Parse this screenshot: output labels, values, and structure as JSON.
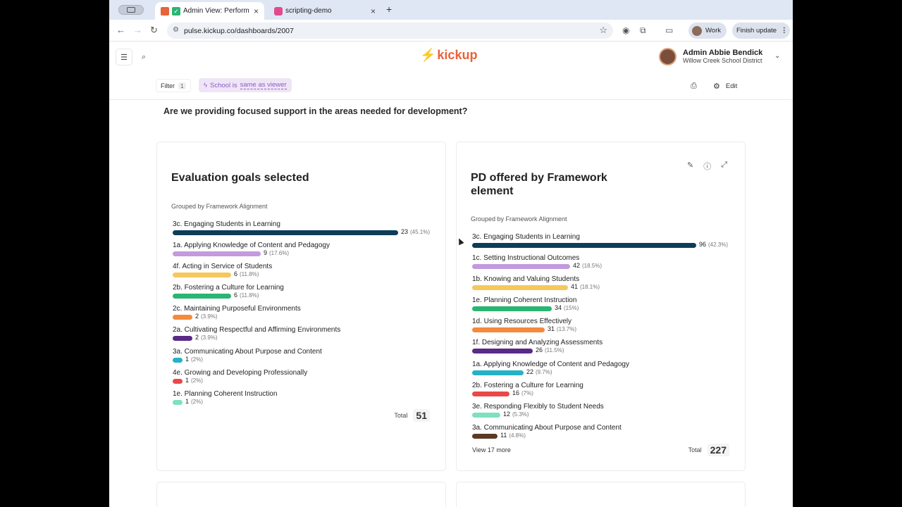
{
  "browser": {
    "tabs": [
      {
        "title": "Admin View: Performance",
        "active": true
      },
      {
        "title": "scripting-demo",
        "active": false
      }
    ],
    "new_tab": "+",
    "close_glyph": "×",
    "url": "pulse.kickup.co/dashboards/2007",
    "profile_label": "Work",
    "finish_update_label": "Finish update"
  },
  "app": {
    "logo_text": "kickup",
    "user_name": "Admin Abbie Bendick",
    "user_org": "Willow Creek School District"
  },
  "filters": {
    "filter_label": "Filter",
    "filter_count": "1",
    "chip_field": "School is",
    "chip_value": "same as viewer",
    "edit_label": "Edit"
  },
  "section": {
    "question": "Are we providing focused support in the areas needed for development?"
  },
  "colors": {
    "brand": "#e8623a",
    "chip_text": "#8c5dc4"
  },
  "cards": [
    {
      "title": "Evaluation goals selected",
      "subtitle": "Grouped by Framework Alignment",
      "total_label": "Total",
      "total_value": "51",
      "max": 23,
      "rows": [
        {
          "label": "3c. Engaging Students in Learning",
          "value": 23,
          "value_text": "23",
          "pct": "(45.1%)",
          "color": "#0d3d57"
        },
        {
          "label": "1a. Applying Knowledge of Content and Pedagogy",
          "value": 9,
          "value_text": "9",
          "pct": "(17.6%)",
          "color": "#c39ade"
        },
        {
          "label": "4f. Acting in Service of Students",
          "value": 6,
          "value_text": "6",
          "pct": "(11.8%)",
          "color": "#f6c75d"
        },
        {
          "label": "2b. Fostering a Culture for Learning",
          "value": 6,
          "value_text": "6",
          "pct": "(11.8%)",
          "color": "#2bb573"
        },
        {
          "label": "2c. Maintaining Purposeful Environments",
          "value": 2,
          "value_text": "2",
          "pct": "(3.9%)",
          "color": "#f58a3c"
        },
        {
          "label": "2a. Cultivating Respectful and Affirming Environments",
          "value": 2,
          "value_text": "2",
          "pct": "(3.9%)",
          "color": "#5a2a86"
        },
        {
          "label": "3a. Communicating About Purpose and Content",
          "value": 1,
          "value_text": "1",
          "pct": "(2%)",
          "color": "#25b1c6"
        },
        {
          "label": "4e. Growing and Developing Professionally",
          "value": 1,
          "value_text": "1",
          "pct": "(2%)",
          "color": "#ea4848"
        },
        {
          "label": "1e. Planning Coherent Instruction",
          "value": 1,
          "value_text": "1",
          "pct": "(2%)",
          "color": "#7ee0bf"
        }
      ]
    },
    {
      "title": "PD offered by Framework element",
      "subtitle": "Grouped by Framework Alignment",
      "total_label": "Total",
      "total_value": "227",
      "view_more": "View 17 more",
      "max": 96,
      "rows": [
        {
          "label": "3c. Engaging Students in Learning",
          "value": 96,
          "value_text": "96",
          "pct": "(42.3%)",
          "color": "#0d3d57"
        },
        {
          "label": "1c. Setting Instructional Outcomes",
          "value": 42,
          "value_text": "42",
          "pct": "(18.5%)",
          "color": "#c39ade"
        },
        {
          "label": "1b. Knowing and Valuing Students",
          "value": 41,
          "value_text": "41",
          "pct": "(18.1%)",
          "color": "#f6c75d"
        },
        {
          "label": "1e. Planning Coherent Instruction",
          "value": 34,
          "value_text": "34",
          "pct": "(15%)",
          "color": "#2bb573"
        },
        {
          "label": "1d. Using Resources Effectively",
          "value": 31,
          "value_text": "31",
          "pct": "(13.7%)",
          "color": "#f58a3c"
        },
        {
          "label": "1f. Designing and Analyzing Assessments",
          "value": 26,
          "value_text": "26",
          "pct": "(11.5%)",
          "color": "#5a2a86"
        },
        {
          "label": "1a. Applying Knowledge of Content and Pedagogy",
          "value": 22,
          "value_text": "22",
          "pct": "(9.7%)",
          "color": "#25b1c6"
        },
        {
          "label": "2b. Fostering a Culture for Learning",
          "value": 16,
          "value_text": "16",
          "pct": "(7%)",
          "color": "#ea4848"
        },
        {
          "label": "3e. Responding Flexibly to Student Needs",
          "value": 12,
          "value_text": "12",
          "pct": "(5.3%)",
          "color": "#7ee0bf"
        },
        {
          "label": "3a. Communicating About Purpose and Content",
          "value": 11,
          "value_text": "11",
          "pct": "(4.8%)",
          "color": "#5b3a22"
        }
      ]
    }
  ]
}
